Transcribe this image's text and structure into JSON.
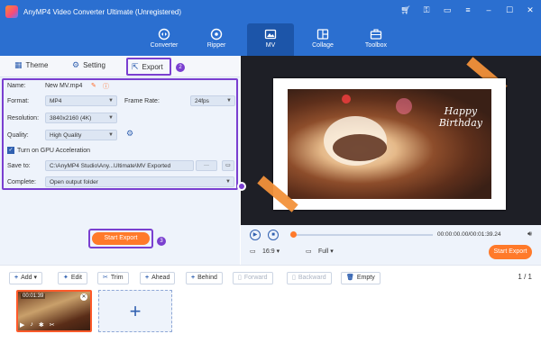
{
  "window": {
    "title": "AnyMP4 Video Converter Ultimate (Unregistered)",
    "icons": [
      "cart-icon",
      "key-icon",
      "chat-icon",
      "menu-icon",
      "minimize-icon",
      "maximize-icon",
      "close-icon"
    ]
  },
  "nav": {
    "items": [
      {
        "label": "Converter",
        "icon": "converter-icon"
      },
      {
        "label": "Ripper",
        "icon": "ripper-icon"
      },
      {
        "label": "MV",
        "icon": "mv-icon",
        "active": true
      },
      {
        "label": "Collage",
        "icon": "collage-icon"
      },
      {
        "label": "Toolbox",
        "icon": "toolbox-icon"
      }
    ]
  },
  "tabs": {
    "theme": "Theme",
    "setting": "Setting",
    "export": "Export",
    "export_step": "2"
  },
  "export_settings": {
    "name_label": "Name:",
    "name_value": "New MV.mp4",
    "format_label": "Format:",
    "format_value": "MP4",
    "frame_rate_label": "Frame Rate:",
    "frame_rate_value": "24fps",
    "resolution_label": "Resolution:",
    "resolution_value": "3840x2160 (4K)",
    "quality_label": "Quality:",
    "quality_value": "High Quality",
    "gpu_label": "Turn on GPU Acceleration",
    "gpu_checked": true,
    "save_to_label": "Save to:",
    "save_to_value": "C:\\AnyMP4 Studio\\Any...Ultimate\\MV Exported",
    "browse_label": "···",
    "complete_label": "Complete:",
    "complete_value": "Open output folder"
  },
  "start_export": {
    "label": "Start Export",
    "step": "3"
  },
  "preview": {
    "caption_line1": "Happy",
    "caption_line2": "Birthday"
  },
  "player": {
    "time": "00:00:00.00/00:01:39.24",
    "aspect": "16:9",
    "zoom": "Full",
    "export_label": "Start Export"
  },
  "edit_toolbar": {
    "add": "Add",
    "edit": "Edit",
    "trim": "Trim",
    "ahead": "Ahead",
    "behind": "Behind",
    "forward": "Forward",
    "backward": "Backward",
    "empty": "Empty",
    "page": "1 / 1"
  },
  "timeline": {
    "clip_length": "00:01:39",
    "add_symbol": "+"
  },
  "colors": {
    "brand_blue": "#2b6fd0",
    "accent_orange": "#ff7a2a",
    "highlight_purple": "#7a3fd0"
  }
}
